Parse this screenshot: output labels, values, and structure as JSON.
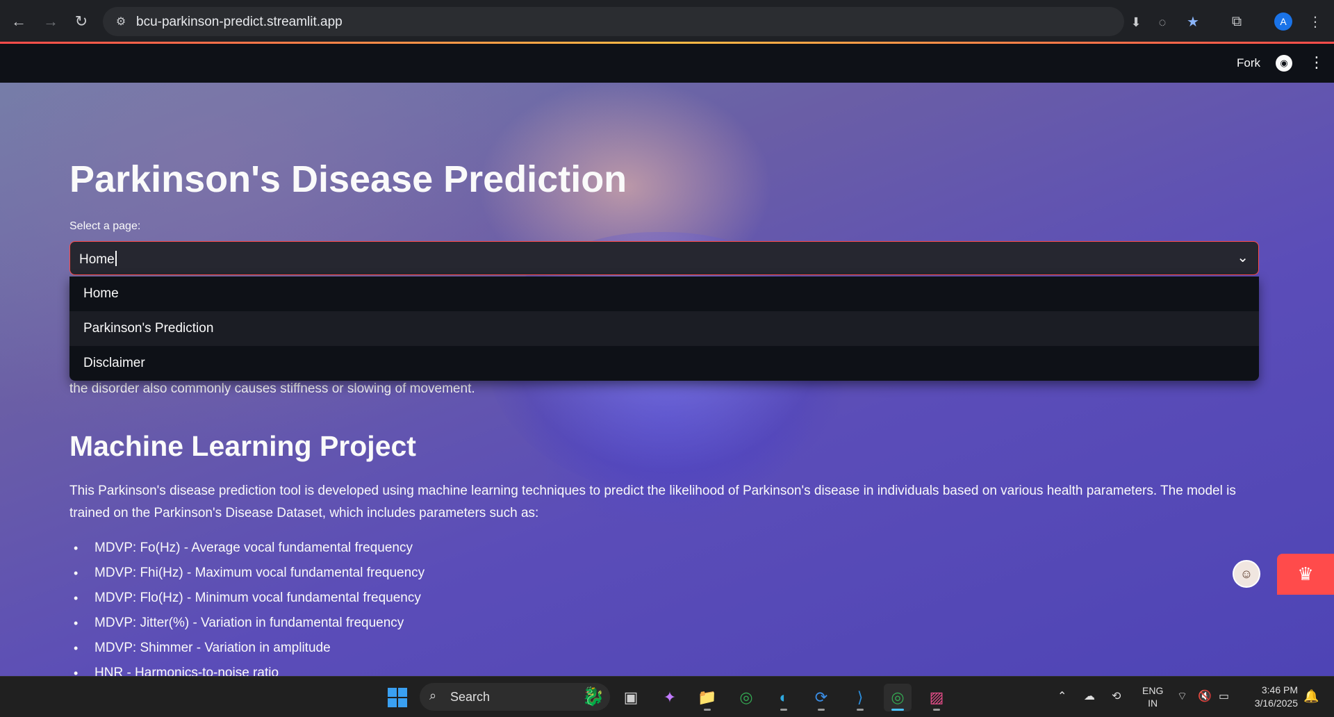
{
  "browser": {
    "url": "bcu-parkinson-predict.streamlit.app",
    "profile_initial": "A"
  },
  "header": {
    "fork_label": "Fork"
  },
  "main": {
    "title": "Parkinson's Disease Prediction",
    "select_label": "Select a page:",
    "select_value": "Home",
    "options": [
      "Home",
      "Parkinson's Prediction",
      "Disclaimer"
    ],
    "intro_tail": "the disorder also commonly causes stiffness or slowing of movement.",
    "section_title": "Machine Learning Project",
    "section_text": "This Parkinson's disease prediction tool is developed using machine learning techniques to predict the likelihood of Parkinson's disease in individuals based on various health parameters. The model is trained on the Parkinson's Disease Dataset, which includes parameters such as:",
    "params": [
      "MDVP: Fo(Hz) - Average vocal fundamental frequency",
      "MDVP: Fhi(Hz) - Maximum vocal fundamental frequency",
      "MDVP: Flo(Hz) - Minimum vocal fundamental frequency",
      "MDVP: Jitter(%) - Variation in fundamental frequency",
      "MDVP: Shimmer - Variation in amplitude",
      "HNR - Harmonics-to-noise ratio"
    ]
  },
  "taskbar": {
    "search_label": "Search",
    "lang_top": "ENG",
    "lang_bottom": "IN",
    "time": "3:46 PM",
    "date": "3/16/2025"
  }
}
